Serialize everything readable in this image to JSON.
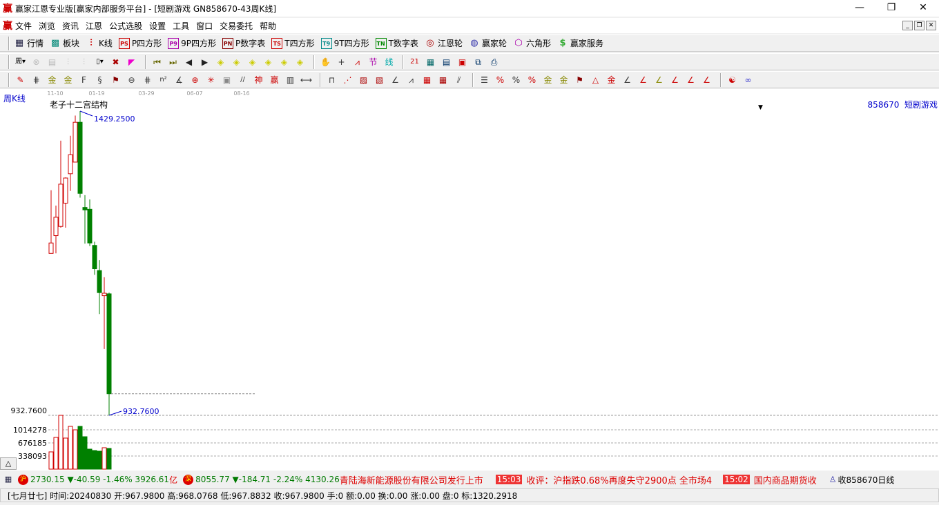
{
  "window": {
    "logo": "赢",
    "title": "赢家江恩专业版[赢家内部服务平台] - [短剧游戏  GN858670-43周K线]",
    "minimize": "—",
    "restore": "❐",
    "close": "✕"
  },
  "menu": [
    "文件",
    "浏览",
    "资讯",
    "江恩",
    "公式选股",
    "设置",
    "工具",
    "窗口",
    "交易委托",
    "帮助"
  ],
  "toolbar1": [
    {
      "icon": "quote-table-icon",
      "glyph": "▦",
      "label": "行情",
      "color": "#224"
    },
    {
      "icon": "sector-grid-icon",
      "glyph": "▩",
      "label": "板块",
      "color": "#087"
    },
    {
      "icon": "candlestick-icon",
      "glyph": "⫶",
      "label": "K线",
      "color": "#c00"
    },
    {
      "icon": "ps-square-icon",
      "glyph": "PS",
      "label": "P四方形",
      "color": "#c00"
    },
    {
      "icon": "p9-square-icon",
      "glyph": "P9",
      "label": "9P四方形",
      "color": "#a0a"
    },
    {
      "icon": "pn-table-icon",
      "glyph": "PN",
      "label": "P数字表",
      "color": "#800"
    },
    {
      "icon": "ts-square-icon",
      "glyph": "TS",
      "label": "T四方形",
      "color": "#c00"
    },
    {
      "icon": "t9-square-icon",
      "glyph": "T9",
      "label": "9T四方形",
      "color": "#088"
    },
    {
      "icon": "tn-table-icon",
      "glyph": "TN",
      "label": "T数字表",
      "color": "#080"
    },
    {
      "icon": "gann-wheel-icon",
      "glyph": "◎",
      "label": "江恩轮",
      "color": "#a00"
    },
    {
      "icon": "winner-wheel-icon",
      "glyph": "◍",
      "label": "赢家轮",
      "color": "#33a"
    },
    {
      "icon": "hexagon-icon",
      "glyph": "⬡",
      "label": "六角形",
      "color": "#a0a"
    },
    {
      "icon": "dollar-icon",
      "glyph": "$",
      "label": "赢家服务",
      "color": "#3a3"
    }
  ],
  "toolbar2": [
    [
      "period-week-icon",
      "周▾",
      "#000"
    ],
    [
      "disabled-tool-icon",
      "⊗",
      "#bbb"
    ],
    [
      "disabled-doc-icon",
      "▤",
      "#bbb"
    ],
    [
      "disabled-n3-icon",
      "⫶",
      "#bbb"
    ],
    [
      "disabled-n9-icon",
      "⫶",
      "#bbb"
    ],
    [
      "candle-type-dropdown-icon",
      "▯▾",
      "#000"
    ],
    [
      "formula-icon",
      "✖",
      "#a00"
    ],
    [
      "pink-flag-icon",
      "◤",
      "#e0c"
    ],
    "sep",
    [
      "first-page-icon",
      "⏮",
      "#660"
    ],
    [
      "last-page-icon",
      "⏭",
      "#660"
    ],
    [
      "arrow-left-icon",
      "◀",
      "#222"
    ],
    [
      "arrow-right-icon",
      "▶",
      "#222"
    ],
    [
      "diamond-left-icon",
      "◈",
      "#cc0"
    ],
    [
      "diamond-right-icon",
      "◈",
      "#cc0"
    ],
    [
      "diamond-expand-icon",
      "◈",
      "#cc0"
    ],
    [
      "diamond-shrink-icon",
      "◈",
      "#cc0"
    ],
    [
      "diamond-zoom-in-icon",
      "◈",
      "#cc0"
    ],
    [
      "diamond-zoom-out-icon",
      "◈",
      "#cc0"
    ],
    "sep",
    [
      "hand-pan-icon",
      "✋",
      "#333"
    ],
    [
      "crosshair-icon",
      "+",
      "#333"
    ],
    [
      "trend-line-icon",
      "⩘",
      "#c00"
    ],
    [
      "node-icon",
      "节",
      "#a0a"
    ],
    [
      "line-tool-icon",
      "线",
      "#0aa"
    ],
    "sep",
    [
      "calendar-21-icon",
      "21",
      "#c00"
    ],
    [
      "calculator-icon",
      "▦",
      "#066"
    ],
    [
      "notebook-icon",
      "▤",
      "#036"
    ],
    [
      "save-disk-icon",
      "▣",
      "#c00"
    ],
    [
      "network-icon",
      "⧉",
      "#036"
    ],
    [
      "print-icon",
      "⎙",
      "#036"
    ]
  ],
  "toolbar3": [
    [
      "pencil-icon",
      "✎",
      "#c00"
    ],
    [
      "grid-lines-icon",
      "⋕",
      "#333"
    ],
    [
      "gold-line-1-icon",
      "金",
      "#880"
    ],
    [
      "gold-line-2-icon",
      "金",
      "#880"
    ],
    [
      "fib-f-icon",
      "F",
      "#333"
    ],
    [
      "spiral-icon",
      "§",
      "#333"
    ],
    [
      "fan-brush-icon",
      "⚑",
      "#800"
    ],
    [
      "circle-scale-icon",
      "⊖",
      "#333"
    ],
    [
      "parallel-lines-icon",
      "⋕",
      "#333"
    ],
    [
      "n-squared-icon",
      "n²",
      "#333"
    ],
    [
      "angle-icon",
      "∡",
      "#333"
    ],
    [
      "target-icon",
      "⊕",
      "#c00"
    ],
    [
      "star-burst-icon",
      "✳",
      "#c00"
    ],
    [
      "square-target-icon",
      "▣",
      "#888"
    ],
    [
      "double-quote-icon",
      "//",
      "#333"
    ],
    [
      "shen-icon",
      "神",
      "#c00"
    ],
    [
      "ying-icon",
      "赢",
      "#c00"
    ],
    [
      "ruler-icon",
      "▥",
      "#333"
    ],
    [
      "measure-icon",
      "⟷",
      "#333"
    ],
    "sep",
    [
      "box-line-icon",
      "⊓",
      "#333"
    ],
    [
      "fan-lines-icon",
      "⋰",
      "#c00"
    ],
    [
      "gann-box-icon",
      "▨",
      "#a00"
    ],
    [
      "gann-grid-icon",
      "▧",
      "#a00"
    ],
    [
      "angle-lines-icon",
      "∠",
      "#333"
    ],
    [
      "zigzag-icon",
      "⩘",
      "#333"
    ],
    [
      "grid-red-icon",
      "▦",
      "#c00"
    ],
    [
      "grid-dark-icon",
      "▦",
      "#a00"
    ],
    [
      "parallel-slant-icon",
      "⫽",
      "#333"
    ],
    "sep",
    [
      "ladder-icon",
      "☰",
      "#333"
    ],
    [
      "percent-line-icon",
      "%",
      "#c00"
    ],
    [
      "percent-icon",
      "%",
      "#333"
    ],
    [
      "percent-levels-icon",
      "%",
      "#c00"
    ],
    [
      "gold-circle-icon",
      "金",
      "#880"
    ],
    [
      "gold-levels-icon",
      "金",
      "#880"
    ],
    [
      "pen-fan-icon",
      "⚑",
      "#800"
    ],
    [
      "pyramid-icon",
      "△",
      "#c00"
    ],
    [
      "gold-red-icon",
      "金",
      "#c00"
    ],
    [
      "angle-j-icon",
      "∠",
      "#333"
    ],
    [
      "angle-f-icon",
      "∠",
      "#c00"
    ],
    [
      "angle-gold-icon",
      "∠",
      "#880"
    ],
    [
      "angle-shen-icon",
      "∠",
      "#c00"
    ],
    [
      "angle-ying-icon",
      "∠",
      "#c00"
    ],
    [
      "angle-four-icon",
      "∠",
      "#c00"
    ],
    "sep",
    [
      "yin-yang-icon",
      "☯",
      "#c00"
    ],
    [
      "infinity-icon",
      "∞",
      "#33c"
    ]
  ],
  "chart": {
    "period_label": "周K线",
    "indicator_name": "老子十二宫结构",
    "security": "858670  短剧游戏",
    "time_ticks": [
      "11-10",
      "01-19",
      "03-29",
      "06-07",
      "08-16"
    ],
    "high_label": "1429.2500",
    "low_label": "932.7600",
    "axis_price_label": "932.7600",
    "volume_ticks": [
      "1014278",
      "676185",
      "338093"
    ],
    "collapse_button": "△"
  },
  "chart_data": {
    "type": "candlestick",
    "candles": [
      {
        "o": 1197,
        "h": 1300,
        "l": 1197,
        "c": 1214
      },
      {
        "o": 1226,
        "h": 1275,
        "l": 1197,
        "c": 1256
      },
      {
        "o": 1241,
        "h": 1381,
        "l": 1239,
        "c": 1310
      },
      {
        "o": 1279,
        "h": 1321,
        "l": 1239,
        "c": 1320
      },
      {
        "o": 1327,
        "h": 1389,
        "l": 1299,
        "c": 1358
      },
      {
        "o": 1346,
        "h": 1422,
        "l": 1346,
        "c": 1411
      },
      {
        "o": 1411,
        "h": 1429.25,
        "l": 1288,
        "c": 1295
      },
      {
        "o": 1272,
        "h": 1292,
        "l": 1213,
        "c": 1268
      },
      {
        "o": 1269,
        "h": 1285,
        "l": 1209,
        "c": 1214
      },
      {
        "o": 1210,
        "h": 1216,
        "l": 1162,
        "c": 1172
      },
      {
        "o": 1169,
        "h": 1186,
        "l": 1098,
        "c": 1133
      },
      {
        "o": 1128,
        "h": 1158,
        "l": 1041,
        "c": 1132
      },
      {
        "o": 1131,
        "h": 1133,
        "l": 932.76,
        "c": 967.98
      }
    ],
    "volumes": [
      445000,
      818000,
      1388000,
      801000,
      1103000,
      1014000,
      1103000,
      836000,
      516000,
      480000,
      463000,
      552000,
      534000
    ],
    "price_range": [
      932.76,
      1429.25
    ],
    "up_color": "#d00000",
    "down_color": "#008000"
  },
  "ticker": {
    "sh_badge": "沪",
    "sh": "2730.15 ▼-40.59 -1.46% 3926.61",
    "sh_unit": "亿",
    "sz_badge": "深",
    "sz": "8055.77 ▼-184.71 -2.24% 4130.26",
    "news1": "青陆海新能源股份有限公司发行上市",
    "time1": "15:03",
    "news2": "收评：沪指跌0.68%再度失守2900点 全市场4",
    "time2": "15:02",
    "news3": "国内商品期货收",
    "alert": "收858670日线"
  },
  "infobar": "[七月廿七] 时间:20240830 开:967.9800 高:968.0768 低:967.8832 收:967.9800 手:0 额:0.00 换:0.00 涨:0.00 盘:0 标:1320.2918"
}
